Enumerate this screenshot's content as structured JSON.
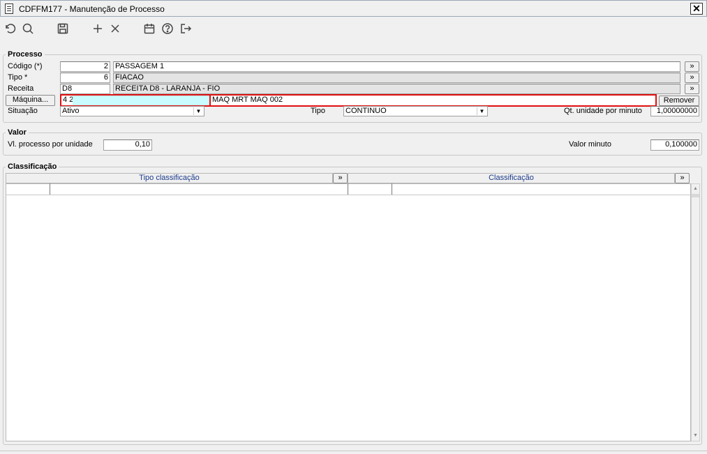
{
  "window": {
    "title": "CDFFM177 - Manutenção de Processo",
    "close_label": "✕"
  },
  "toolbar": {
    "icons": [
      "undo-icon",
      "search-icon",
      "save-icon",
      "add-icon",
      "delete-icon",
      "calendar-icon",
      "help-icon",
      "exit-icon"
    ]
  },
  "processo": {
    "group_label": "Processo",
    "codigo": {
      "label": "Código (*)",
      "value": "2",
      "desc": "PASSAGEM 1"
    },
    "tipo": {
      "label": "Tipo *",
      "value": "6",
      "desc": "FIACAO"
    },
    "receita": {
      "label": "Receita",
      "value": "D8",
      "desc": "RECEITA D8 - LARANJA - FIO"
    },
    "maquina": {
      "button_label": "Máquina...",
      "code": "4 2",
      "code2": "",
      "desc": "MAQ MRT MAQ 002",
      "remove_label": "Remover"
    },
    "situacao": {
      "label": "Situação",
      "value": "Ativo"
    },
    "tipo2": {
      "label": "Tipo",
      "value": "CONTINUO"
    },
    "qt": {
      "label": "Qt. unidade por minuto",
      "value": "1,00000000"
    },
    "lookup_label": "»"
  },
  "valor": {
    "group_label": "Valor",
    "vl_processo": {
      "label": "Vl. processo por unidade",
      "value": "0,10"
    },
    "valor_minuto": {
      "label": "Valor minuto",
      "value": "0,100000"
    }
  },
  "classificacao": {
    "group_label": "Classificação",
    "columns": [
      {
        "label": "Tipo classificação"
      },
      {
        "label": "Classificação"
      }
    ],
    "lookup_label": "»"
  },
  "colors": {
    "highlight_border": "#e01010",
    "highlight_fill": "#c8fcff",
    "header_text": "#1a3a8a"
  }
}
